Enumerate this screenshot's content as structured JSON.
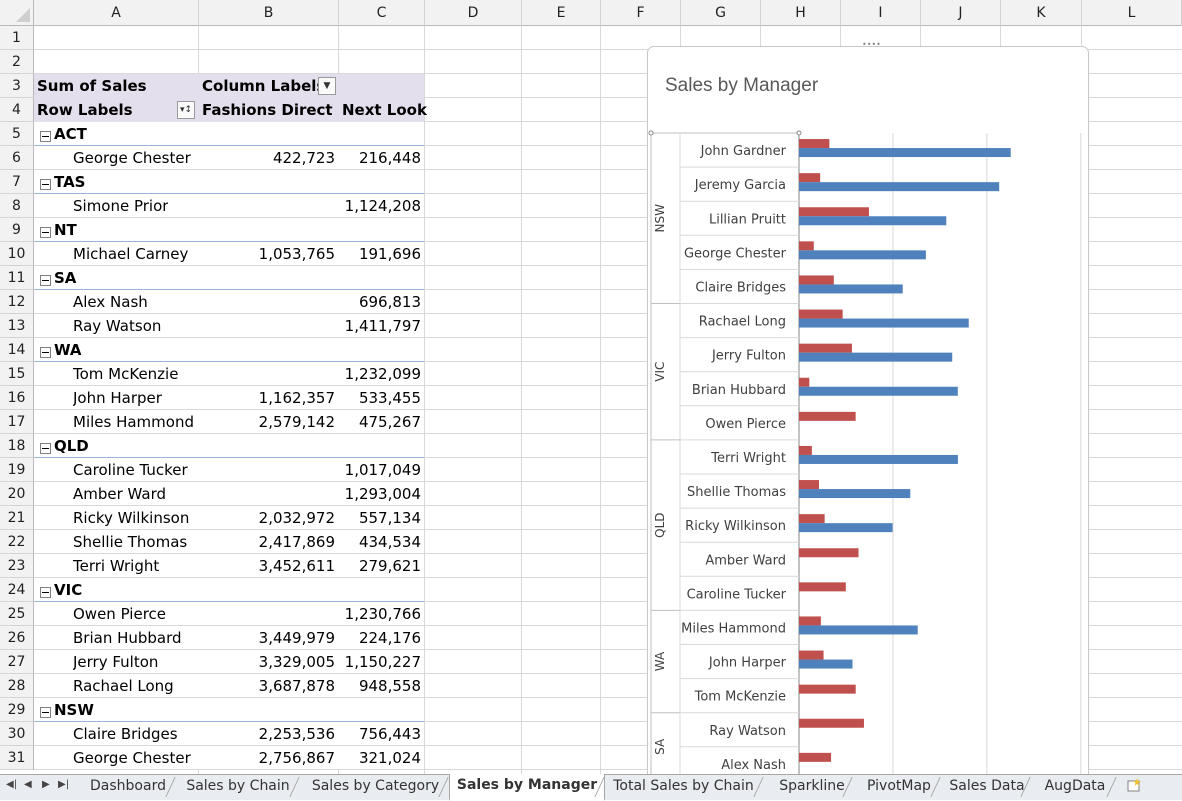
{
  "sheet": {
    "columns": [
      "A",
      "B",
      "C",
      "D",
      "E",
      "F",
      "G",
      "H",
      "I",
      "J",
      "K",
      "L"
    ],
    "row_numbers": [
      "1",
      "2",
      "3",
      "4",
      "5",
      "6",
      "7",
      "8",
      "9",
      "10",
      "11",
      "12",
      "13",
      "14",
      "15",
      "16",
      "17",
      "18",
      "19",
      "20",
      "21",
      "22",
      "23",
      "24",
      "25",
      "26",
      "27",
      "28",
      "29",
      "30",
      "31"
    ]
  },
  "pivot": {
    "sum_label": "Sum of Sales",
    "column_labels": "Column Labels",
    "row_labels": "Row Labels",
    "col_fashions": "Fashions Direct",
    "col_nextlook": "Next Look",
    "rows": [
      {
        "type": "group",
        "label": "ACT"
      },
      {
        "type": "item",
        "label": "George Chester",
        "b": "422,723",
        "c": "216,448"
      },
      {
        "type": "group",
        "label": "TAS"
      },
      {
        "type": "item",
        "label": "Simone Prior",
        "b": "",
        "c": "1,124,208"
      },
      {
        "type": "group",
        "label": "NT"
      },
      {
        "type": "item",
        "label": "Michael Carney",
        "b": "1,053,765",
        "c": "191,696"
      },
      {
        "type": "group",
        "label": "SA"
      },
      {
        "type": "item",
        "label": "Alex Nash",
        "b": "",
        "c": "696,813"
      },
      {
        "type": "item",
        "label": "Ray Watson",
        "b": "",
        "c": "1,411,797"
      },
      {
        "type": "group",
        "label": "WA"
      },
      {
        "type": "item",
        "label": "Tom McKenzie",
        "b": "",
        "c": "1,232,099"
      },
      {
        "type": "item",
        "label": "John Harper",
        "b": "1,162,357",
        "c": "533,455"
      },
      {
        "type": "item",
        "label": "Miles Hammond",
        "b": "2,579,142",
        "c": "475,267"
      },
      {
        "type": "group",
        "label": "QLD"
      },
      {
        "type": "item",
        "label": "Caroline Tucker",
        "b": "",
        "c": "1,017,049"
      },
      {
        "type": "item",
        "label": "Amber Ward",
        "b": "",
        "c": "1,293,004"
      },
      {
        "type": "item",
        "label": "Ricky Wilkinson",
        "b": "2,032,972",
        "c": "557,134"
      },
      {
        "type": "item",
        "label": "Shellie Thomas",
        "b": "2,417,869",
        "c": "434,534"
      },
      {
        "type": "item",
        "label": "Terri Wright",
        "b": "3,452,611",
        "c": "279,621"
      },
      {
        "type": "group",
        "label": "VIC"
      },
      {
        "type": "item",
        "label": "Owen Pierce",
        "b": "",
        "c": "1,230,766"
      },
      {
        "type": "item",
        "label": "Brian Hubbard",
        "b": "3,449,979",
        "c": "224,176"
      },
      {
        "type": "item",
        "label": "Jerry Fulton",
        "b": "3,329,005",
        "c": "1,150,227"
      },
      {
        "type": "item",
        "label": "Rachael Long",
        "b": "3,687,878",
        "c": "948,558"
      },
      {
        "type": "group",
        "label": "NSW"
      },
      {
        "type": "item",
        "label": "Claire Bridges",
        "b": "2,253,536",
        "c": "756,443"
      },
      {
        "type": "item",
        "label": "George Chester",
        "b": "2,756,867",
        "c": "321,024"
      }
    ]
  },
  "chart_data": {
    "type": "bar",
    "title": "Sales by Manager",
    "orientation": "horizontal",
    "colors": {
      "fashions_direct": "#4f81bd",
      "next_look": "#c0504d"
    },
    "groups": [
      {
        "name": "NSW",
        "managers": [
          "John Gardner",
          "Jeremy Garcia",
          "Lillian Pruitt",
          "George Chester",
          "Claire Bridges"
        ]
      },
      {
        "name": "VIC",
        "managers": [
          "Rachael Long",
          "Jerry Fulton",
          "Brian Hubbard",
          "Owen Pierce"
        ]
      },
      {
        "name": "QLD",
        "managers": [
          "Terri Wright",
          "Shellie Thomas",
          "Ricky Wilkinson",
          "Amber Ward",
          "Caroline Tucker"
        ]
      },
      {
        "name": "WA",
        "managers": [
          "Miles Hammond",
          "John Harper",
          "Tom McKenzie"
        ]
      },
      {
        "name": "SA",
        "managers": [
          "Ray Watson",
          "Alex Nash"
        ]
      }
    ],
    "series": [
      {
        "key": "fashions_direct",
        "values": [
          4600000,
          4350000,
          3200000,
          2756867,
          2253536,
          3687878,
          3329005,
          3449979,
          0,
          3452611,
          2417869,
          2032972,
          0,
          0,
          2579142,
          1162357,
          0,
          0,
          0
        ]
      },
      {
        "key": "next_look",
        "values": [
          660000,
          460000,
          1520000,
          321024,
          756443,
          948558,
          1150227,
          224176,
          1230766,
          279621,
          434534,
          557134,
          1293004,
          1017049,
          475267,
          533455,
          1232099,
          1411797,
          696813
        ]
      }
    ],
    "xlim": [
      0,
      8000000
    ],
    "grid": true
  },
  "tabs": {
    "items": [
      "Dashboard",
      "Sales by Chain",
      "Sales by Category",
      "Sales by Manager",
      "Total Sales by Chain",
      "Sparkline",
      "PivotMap",
      "Sales Data",
      "AugData"
    ],
    "active": "Sales by Manager"
  },
  "icons": {
    "new_sheet": "new-sheet-icon",
    "filter": "filter-dropdown-icon"
  }
}
